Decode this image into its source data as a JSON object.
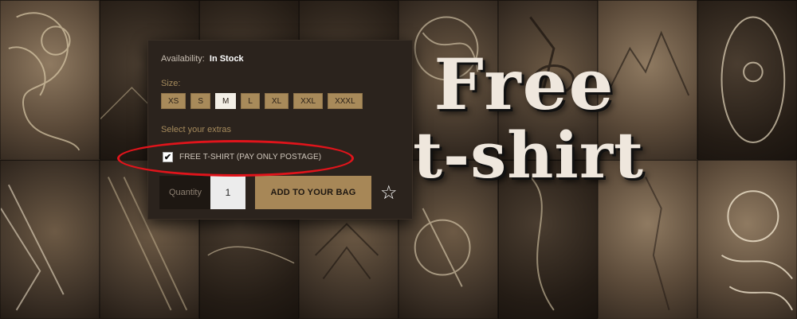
{
  "product": {
    "availability_label": "Availability:",
    "availability_value": "In Stock",
    "size_label": "Size:",
    "sizes": [
      "XS",
      "S",
      "M",
      "L",
      "XL",
      "XXL",
      "XXXL"
    ],
    "selected_size": "M",
    "extras_label": "Select your extras",
    "extra_option": "FREE T-SHIRT (PAY ONLY POSTAGE)",
    "extra_checked": true,
    "quantity_label": "Quantity",
    "quantity_value": "1",
    "add_button": "ADD TO YOUR BAG"
  },
  "promo": {
    "line1": "Free",
    "line2": "t-shirt"
  },
  "icons": {
    "checkmark": "checkmark-icon",
    "star": "star-icon"
  },
  "colors": {
    "accent": "#a78757",
    "highlight_oval": "#e0141b",
    "panel": "#2b231d"
  }
}
